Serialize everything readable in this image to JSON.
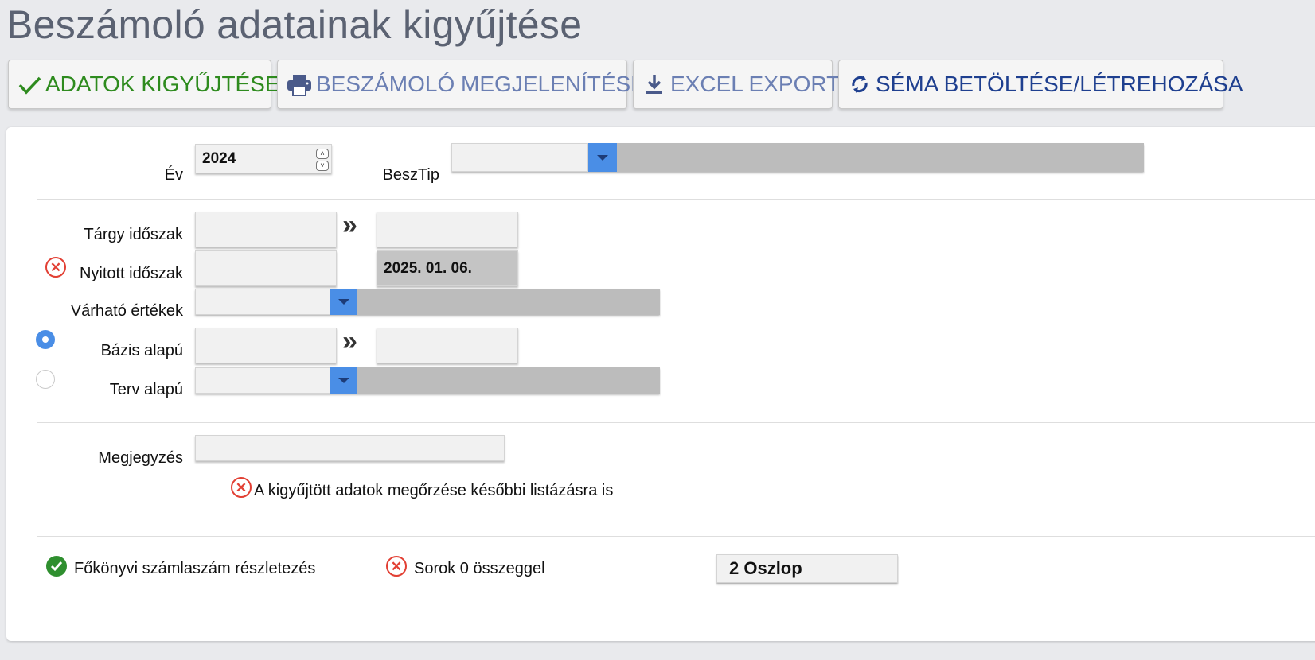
{
  "page": {
    "title": "Beszámoló adatainak kigyűjtése"
  },
  "toolbar": {
    "collect_label": "ADATOK KIGYŰJTÉSE",
    "display_label": "BESZÁMOLÓ MEGJELENÍTÉSE",
    "export_label": "EXCEL EXPORT",
    "schema_label": "SÉMA BETÖLTÉSE/LÉTREHOZÁSA",
    "colors": {
      "collect": "#2e8b1e",
      "display": "#6b7fb3",
      "export": "#6b7fb3",
      "schema": "#1e3f8f"
    },
    "icons": [
      "check-icon",
      "printer-icon",
      "download-icon",
      "refresh-icon"
    ]
  },
  "form": {
    "year_label": "Év",
    "year_value": "2024",
    "besztip_label": "BeszTip",
    "besztip_value": "",
    "targy_label": "Tárgy időszak",
    "targy_from": "",
    "targy_to": "",
    "nyitott_label": "Nyitott időszak",
    "nyitott_from": "",
    "nyitott_to": "2025. 01. 06.",
    "varhato_label": "Várható értékek",
    "varhato_value": "",
    "bazis_label": "Bázis alapú",
    "bazis_from": "",
    "bazis_to": "",
    "terv_label": "Terv alapú",
    "terv_value": "",
    "megjegyzes_label": "Megjegyzés",
    "megjegyzes_value": "",
    "preserve_label": "A kigyűjtött adatok megőrzése későbbi listázásra is",
    "fokonyvi_label": "Főkönyvi számlaszám részletezés",
    "sorok_label": "Sorok 0 összeggel",
    "columns_value": "2 Oszlop",
    "bazis_selected": true,
    "terv_selected": false,
    "nyitott_checked": false,
    "preserve_checked": false,
    "fokonyvi_checked": true,
    "sorok_checked": false
  },
  "colors": {
    "accent_blue": "#4a8ee6",
    "error_red": "#e24034",
    "success_green": "#2f8f2f"
  }
}
